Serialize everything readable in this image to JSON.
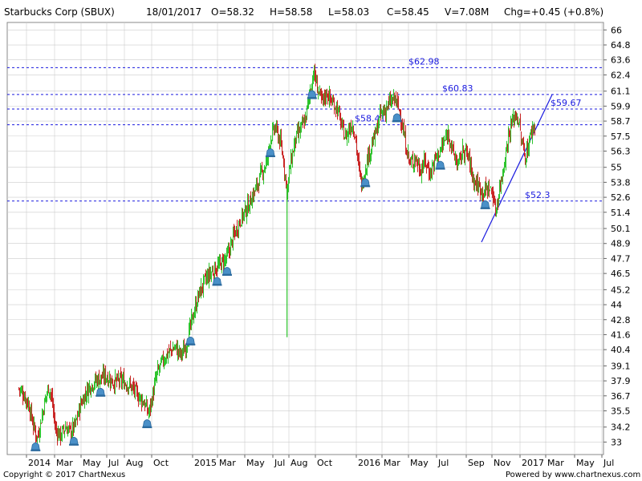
{
  "header": {
    "name": "Starbucks Corp (SBUX)",
    "date": "18/01/2017",
    "open": "O=58.32",
    "high": "H=58.58",
    "low": "L=58.03",
    "close": "C=58.45",
    "volume": "V=7.08M",
    "change": "Chg=+0.45 (+0.8%)"
  },
  "footer": {
    "copyright": "Copyright © 2017 ChartNexus",
    "powered": "Powered by www.chartnexus.com"
  },
  "colors": {
    "up": "#27c227",
    "down": "#c82020",
    "level_line": "#1a1adf",
    "grid": "#cccccc",
    "marker": "#4a90c8"
  },
  "chart_data": {
    "type": "candlestick",
    "title": "Starbucks Corp (SBUX)",
    "ylim": [
      32.0,
      66.6
    ],
    "y_ticks": [
      "33",
      "34.2",
      "35.5",
      "36.7",
      "37.9",
      "39.1",
      "40.4",
      "41.6",
      "42.8",
      "44",
      "45.2",
      "46.5",
      "47.7",
      "48.9",
      "50.1",
      "51.4",
      "52.6",
      "53.8",
      "55",
      "56.3",
      "57.5",
      "58.7",
      "59.9",
      "61.1",
      "62.4",
      "63.6",
      "64.8",
      "66"
    ],
    "x_ticks": [
      "2014",
      "Mar",
      "May",
      "Jul",
      "Aug",
      "Oct",
      "2015",
      "Mar",
      "May",
      "Jul",
      "Aug",
      "Oct",
      "2016",
      "Mar",
      "May",
      "Jul",
      "Sep",
      "Nov",
      "2017",
      "Mar",
      "May",
      "Jul"
    ],
    "levels": [
      {
        "value": 62.98,
        "label": "$62.98"
      },
      {
        "value": 60.83,
        "label": "$60.83"
      },
      {
        "value": 59.67,
        "label": "$59.67"
      },
      {
        "value": 58.41,
        "label": "$58.41"
      },
      {
        "value": 52.3,
        "label": "$52.3"
      }
    ],
    "price_path": [
      [
        2014.0,
        37.3
      ],
      [
        2014.03,
        36.8
      ],
      [
        2014.06,
        36.0
      ],
      [
        2014.09,
        34.2
      ],
      [
        2014.11,
        33.3
      ],
      [
        2014.13,
        34.5
      ],
      [
        2014.16,
        36.5
      ],
      [
        2014.18,
        37.5
      ],
      [
        2014.2,
        36.3
      ],
      [
        2014.22,
        34.0
      ],
      [
        2014.25,
        33.5
      ],
      [
        2014.28,
        34.2
      ],
      [
        2014.31,
        33.8
      ],
      [
        2014.34,
        34.4
      ],
      [
        2014.37,
        36.0
      ],
      [
        2014.42,
        37.4
      ],
      [
        2014.47,
        38.0
      ],
      [
        2014.52,
        38.3
      ],
      [
        2014.57,
        37.8
      ],
      [
        2014.62,
        37.9
      ],
      [
        2014.67,
        37.5
      ],
      [
        2014.7,
        37.0
      ],
      [
        2014.75,
        36.2
      ],
      [
        2014.78,
        35.3
      ],
      [
        2014.8,
        36.5
      ],
      [
        2014.83,
        38.5
      ],
      [
        2014.86,
        39.4
      ],
      [
        2014.9,
        40.2
      ],
      [
        2014.94,
        40.6
      ],
      [
        2014.97,
        40.0
      ],
      [
        2015.0,
        40.5
      ],
      [
        2015.04,
        42.8
      ],
      [
        2015.08,
        44.8
      ],
      [
        2015.12,
        46.0
      ],
      [
        2015.17,
        46.8
      ],
      [
        2015.21,
        47.2
      ],
      [
        2015.25,
        47.8
      ],
      [
        2015.29,
        49.5
      ],
      [
        2015.33,
        50.8
      ],
      [
        2015.38,
        52.0
      ],
      [
        2015.42,
        53.2
      ],
      [
        2015.46,
        54.6
      ],
      [
        2015.49,
        55.5
      ],
      [
        2015.51,
        57.3
      ],
      [
        2015.54,
        58.2
      ],
      [
        2015.57,
        57.0
      ],
      [
        2015.59,
        55.5
      ],
      [
        2015.61,
        53.0
      ],
      [
        2015.63,
        55.2
      ],
      [
        2015.66,
        57.2
      ],
      [
        2015.69,
        58.0
      ],
      [
        2015.72,
        58.8
      ],
      [
        2015.75,
        61.2
      ],
      [
        2015.77,
        62.7
      ],
      [
        2015.79,
        61.5
      ],
      [
        2015.82,
        60.2
      ],
      [
        2015.85,
        61.0
      ],
      [
        2015.88,
        60.2
      ],
      [
        2015.91,
        59.8
      ],
      [
        2015.94,
        58.2
      ],
      [
        2015.96,
        57.4
      ],
      [
        2016.0,
        58.5
      ],
      [
        2016.02,
        57.6
      ],
      [
        2016.04,
        55.0
      ],
      [
        2016.06,
        53.5
      ],
      [
        2016.09,
        55.6
      ],
      [
        2016.12,
        56.8
      ],
      [
        2016.15,
        58.0
      ],
      [
        2016.17,
        59.2
      ],
      [
        2016.2,
        59.6
      ],
      [
        2016.23,
        60.2
      ],
      [
        2016.26,
        60.5
      ],
      [
        2016.29,
        59.3
      ],
      [
        2016.32,
        57.0
      ],
      [
        2016.35,
        55.2
      ],
      [
        2016.38,
        55.8
      ],
      [
        2016.41,
        54.8
      ],
      [
        2016.44,
        55.5
      ],
      [
        2016.47,
        54.5
      ],
      [
        2016.5,
        55.7
      ],
      [
        2016.53,
        56.3
      ],
      [
        2016.56,
        57.2
      ],
      [
        2016.58,
        57.8
      ],
      [
        2016.61,
        56.0
      ],
      [
        2016.64,
        55.2
      ],
      [
        2016.67,
        56.5
      ],
      [
        2016.7,
        55.8
      ],
      [
        2016.73,
        54.0
      ],
      [
        2016.76,
        53.5
      ],
      [
        2016.79,
        53.0
      ],
      [
        2016.82,
        53.4
      ],
      [
        2016.85,
        52.8
      ],
      [
        2016.86,
        51.3
      ],
      [
        2016.88,
        52.8
      ],
      [
        2016.9,
        54.3
      ],
      [
        2016.92,
        55.8
      ],
      [
        2016.94,
        57.6
      ],
      [
        2016.96,
        58.5
      ],
      [
        2016.98,
        59.3
      ],
      [
        2017.0,
        58.8
      ],
      [
        2017.02,
        57.0
      ],
      [
        2017.04,
        55.8
      ],
      [
        2017.06,
        56.8
      ],
      [
        2017.08,
        58.0
      ],
      [
        2017.1,
        58.4
      ]
    ],
    "spikes": [
      {
        "x": 2015.61,
        "low": 41.4,
        "high": 53.6
      }
    ],
    "marker_dates": [
      2014.1,
      2014.33,
      2014.49,
      2014.77,
      2015.03,
      2015.19,
      2015.25,
      2015.51,
      2015.76,
      2016.08,
      2016.27,
      2016.53,
      2016.8
    ]
  }
}
